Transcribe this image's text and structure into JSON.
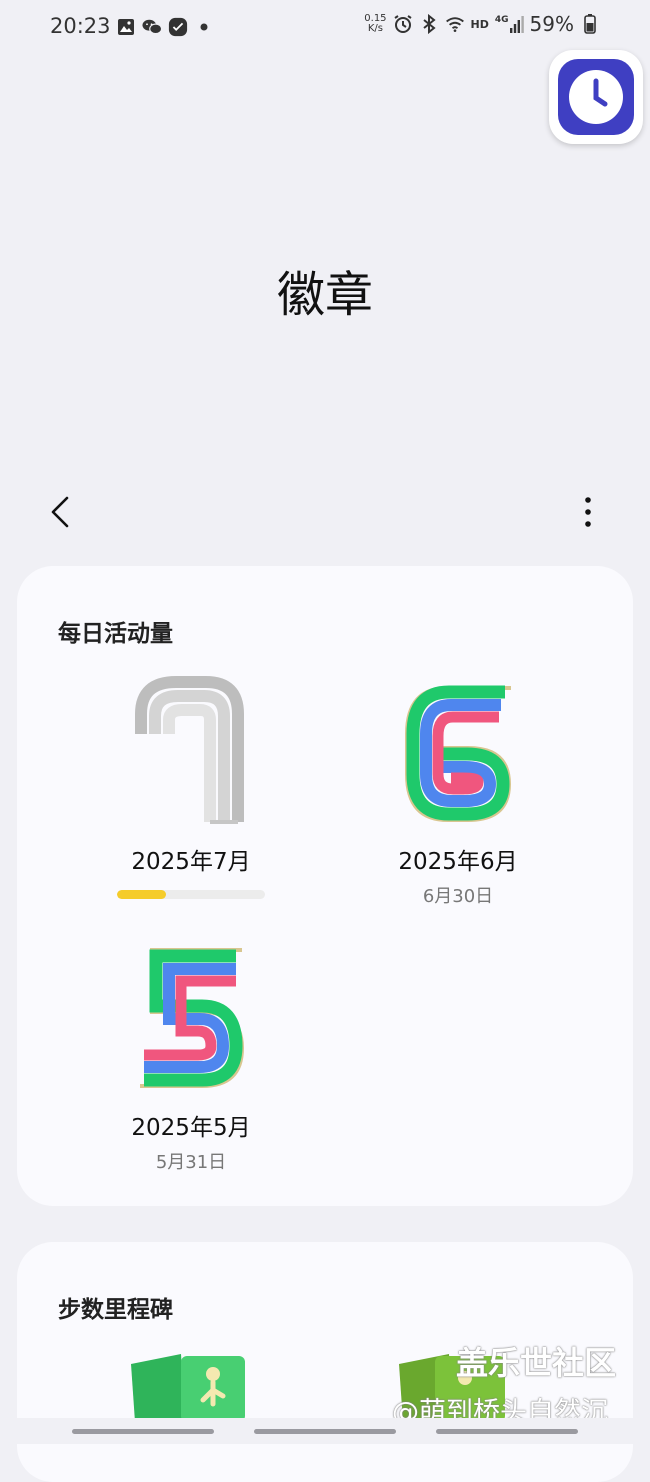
{
  "status": {
    "time": "20:23",
    "net_speed_value": "0.15",
    "net_speed_unit": "K/s",
    "hd": "HD",
    "network": "4G",
    "battery": "59%"
  },
  "page": {
    "title": "徽章"
  },
  "daily_activity": {
    "title": "每日活动量",
    "badges": [
      {
        "label": "2025年7月",
        "date": "",
        "progress": 0.33
      },
      {
        "label": "2025年6月",
        "date": "6月30日"
      },
      {
        "label": "2025年5月",
        "date": "5月31日"
      }
    ]
  },
  "step_milestones": {
    "title": "步数里程碑"
  },
  "watermark": {
    "line1": "盖乐世社区",
    "line2": "@萌到桥头自然沉"
  },
  "colors": {
    "progress": "#f5cc2a",
    "badge_green": "#1fc96b",
    "badge_blue": "#4f86ee",
    "badge_pink": "#f0567e",
    "clock_blue": "#3f3fc2"
  }
}
